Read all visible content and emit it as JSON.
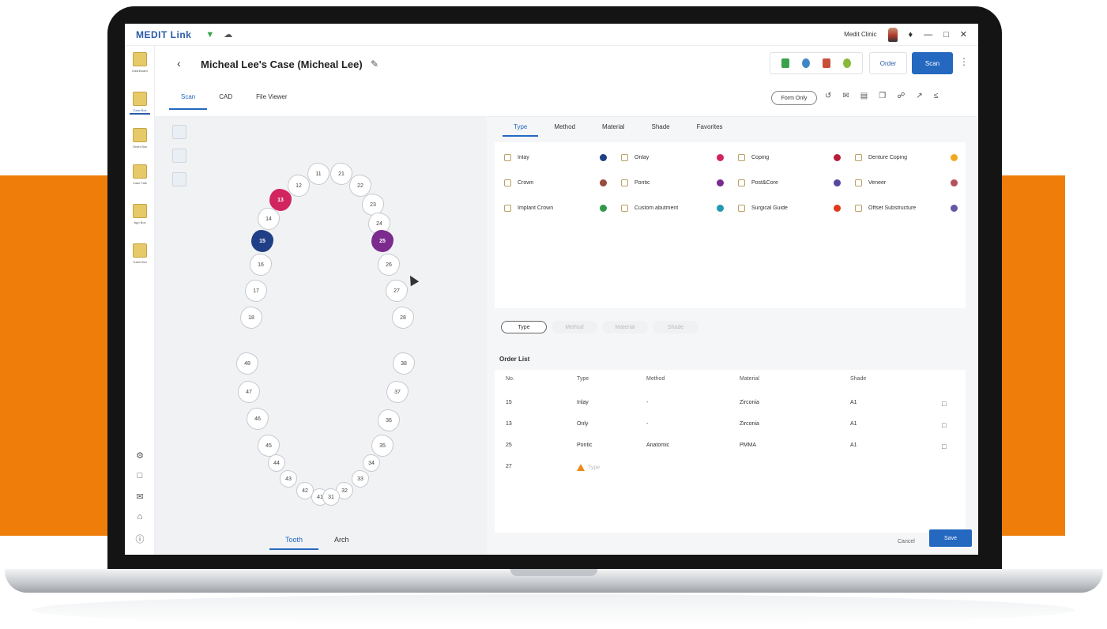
{
  "app": {
    "brand": "MEDIT Link",
    "user": "Medit Clinic"
  },
  "header": {
    "title": "Micheal Lee's Case (Micheal Lee)",
    "order_label": "Order",
    "scan_label": "Scan",
    "form_only_label": "Form Only",
    "tabs": [
      {
        "label": "Scan",
        "active": true
      },
      {
        "label": "CAD",
        "active": false
      },
      {
        "label": "File Viewer",
        "active": false
      }
    ]
  },
  "sidebar": {
    "items": [
      {
        "label": "Dashboard",
        "active": false
      },
      {
        "label": "Case Box",
        "active": true
      },
      {
        "label": "Order Box",
        "active": false
      },
      {
        "label": "Case Talk",
        "active": false
      },
      {
        "label": "App Box",
        "active": false
      },
      {
        "label": "Trash Box",
        "active": false
      }
    ]
  },
  "arch": {
    "tabs": [
      {
        "label": "Tooth",
        "active": true
      },
      {
        "label": "Arch",
        "active": false
      }
    ],
    "teeth": [
      {
        "num": "11",
        "state": "normal"
      },
      {
        "num": "21",
        "state": "normal"
      },
      {
        "num": "12",
        "state": "normal"
      },
      {
        "num": "22",
        "state": "normal"
      },
      {
        "num": "13",
        "state": "red"
      },
      {
        "num": "23",
        "state": "normal"
      },
      {
        "num": "14",
        "state": "normal"
      },
      {
        "num": "24",
        "state": "normal"
      },
      {
        "num": "15",
        "state": "navy"
      },
      {
        "num": "25",
        "state": "purple"
      },
      {
        "num": "16",
        "state": "normal"
      },
      {
        "num": "26",
        "state": "normal"
      },
      {
        "num": "17",
        "state": "normal"
      },
      {
        "num": "27",
        "state": "normal"
      },
      {
        "num": "18",
        "state": "normal"
      },
      {
        "num": "28",
        "state": "normal"
      },
      {
        "num": "48",
        "state": "normal"
      },
      {
        "num": "38",
        "state": "normal"
      },
      {
        "num": "47",
        "state": "normal"
      },
      {
        "num": "37",
        "state": "normal"
      },
      {
        "num": "46",
        "state": "normal"
      },
      {
        "num": "36",
        "state": "normal"
      },
      {
        "num": "45",
        "state": "normal"
      },
      {
        "num": "35",
        "state": "normal"
      },
      {
        "num": "44",
        "state": "normal"
      },
      {
        "num": "34",
        "state": "normal"
      },
      {
        "num": "43",
        "state": "normal"
      },
      {
        "num": "33",
        "state": "normal"
      },
      {
        "num": "42",
        "state": "normal"
      },
      {
        "num": "32",
        "state": "normal"
      },
      {
        "num": "41",
        "state": "normal"
      },
      {
        "num": "31",
        "state": "normal"
      }
    ]
  },
  "prosthesis": {
    "tabs": [
      {
        "label": "Type",
        "active": true
      },
      {
        "label": "Method",
        "active": false
      },
      {
        "label": "Material",
        "active": false
      },
      {
        "label": "Shade",
        "active": false
      },
      {
        "label": "Favorites",
        "active": false
      }
    ],
    "types": [
      {
        "label": "Inlay",
        "color": "#1f3f86"
      },
      {
        "label": "Onlay",
        "color": "#d2245f"
      },
      {
        "label": "Coping",
        "color": "#b81e3a"
      },
      {
        "label": "Denture Coping",
        "color": "#f0a81c"
      },
      {
        "label": "Crown",
        "color": "#9a4a3e"
      },
      {
        "label": "Pontic",
        "color": "#7b2a8e"
      },
      {
        "label": "Post&Core",
        "color": "#5546a0"
      },
      {
        "label": "Veneer",
        "color": "#b5515a"
      },
      {
        "label": "Implant Crown",
        "color": "#2f9a4a"
      },
      {
        "label": "Custom abutment",
        "color": "#1f9ab0"
      },
      {
        "label": "Surgical Guide",
        "color": "#e03a1a"
      },
      {
        "label": "Offset Substructure",
        "color": "#6656a6"
      }
    ],
    "steps": [
      "Type",
      "Method",
      "Material",
      "Shade"
    ]
  },
  "order_list": {
    "title": "Order List",
    "headers": [
      "No.",
      "Type",
      "Method",
      "Material",
      "Shade"
    ],
    "rows": [
      {
        "no": "15",
        "type": "Inlay",
        "method": "-",
        "material": "Zirconia",
        "shade": "A1",
        "pending": false
      },
      {
        "no": "13",
        "type": "Only",
        "method": "-",
        "material": "Zirconia",
        "shade": "A1",
        "pending": false
      },
      {
        "no": "25",
        "type": "Pontic",
        "method": "Anatomic",
        "material": "PMMA",
        "shade": "A1",
        "pending": false
      },
      {
        "no": "27",
        "type": "Type",
        "method": "",
        "material": "",
        "shade": "",
        "pending": true
      }
    ]
  },
  "footer": {
    "cancel_label": "Cancel",
    "save_label": "Save"
  }
}
